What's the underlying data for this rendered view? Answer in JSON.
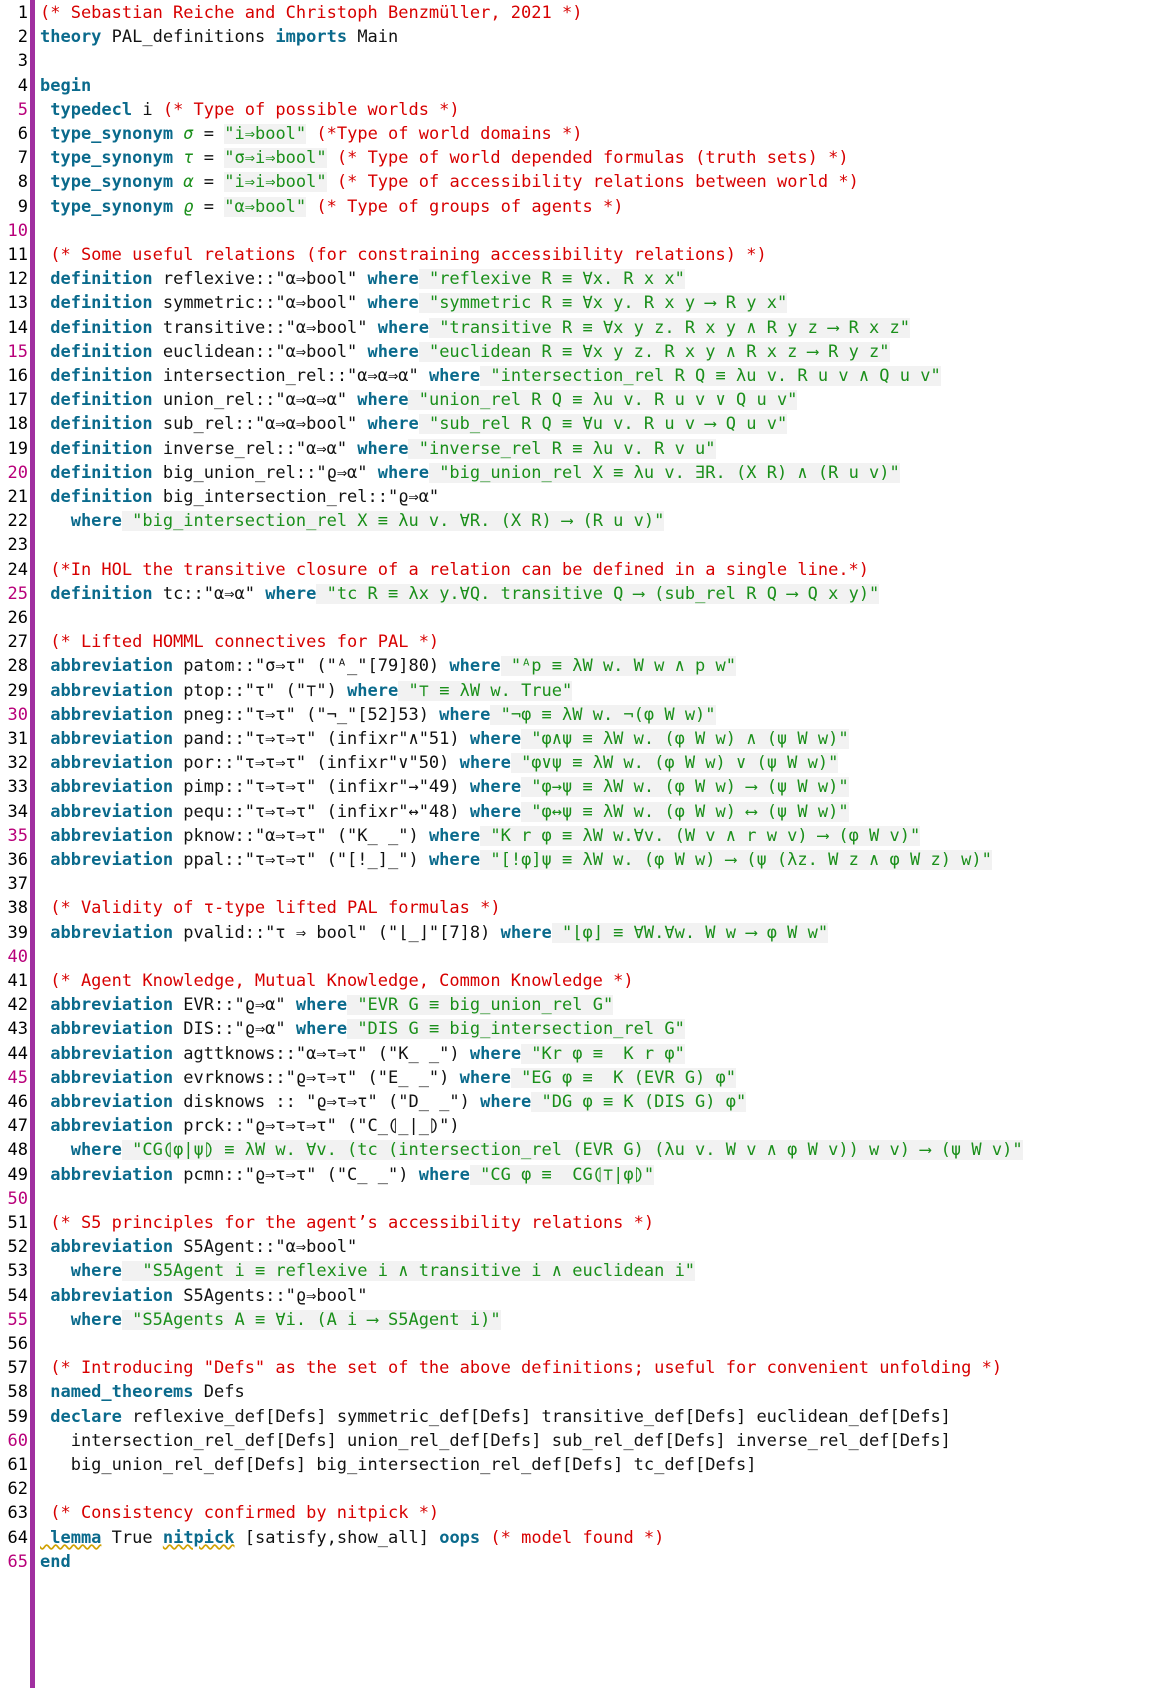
{
  "editor": {
    "title": "PAL_definitions.thy",
    "lines": [
      {
        "n": "1",
        "s": [
          {
            "c": "cm",
            "t": "(* Sebastian Reiche and Christoph Benzmüller, 2021 *)"
          }
        ]
      },
      {
        "n": "2",
        "s": [
          {
            "c": "kw",
            "t": "theory"
          },
          {
            "c": "txt",
            "t": " PAL_definitions "
          },
          {
            "c": "kw",
            "t": "imports"
          },
          {
            "c": "txt",
            "t": " Main"
          }
        ]
      },
      {
        "n": "3",
        "s": []
      },
      {
        "n": "4",
        "s": [
          {
            "c": "kw",
            "t": "begin"
          }
        ]
      },
      {
        "n": "5",
        "mark": true,
        "s": [
          {
            "c": "kw",
            "t": " typedecl"
          },
          {
            "c": "txt",
            "t": " i "
          },
          {
            "c": "cm",
            "t": "(* Type of possible worlds *)"
          }
        ]
      },
      {
        "n": "6",
        "s": [
          {
            "c": "kw",
            "t": " type_synonym"
          },
          {
            "c": "ital",
            "t": " σ"
          },
          {
            "c": "txt",
            "t": " = "
          },
          {
            "c": "str",
            "t": "\"i⇒bool\""
          },
          {
            "c": "cm",
            "t": " (*Type of world domains *)"
          }
        ]
      },
      {
        "n": "7",
        "s": [
          {
            "c": "kw",
            "t": " type_synonym"
          },
          {
            "c": "ital",
            "t": " τ"
          },
          {
            "c": "txt",
            "t": " = "
          },
          {
            "c": "str",
            "t": "\"σ⇒i⇒bool\""
          },
          {
            "c": "cm",
            "t": " (* Type of world depended formulas (truth sets) *)"
          }
        ]
      },
      {
        "n": "8",
        "s": [
          {
            "c": "kw",
            "t": " type_synonym"
          },
          {
            "c": "ital",
            "t": " α"
          },
          {
            "c": "txt",
            "t": " = "
          },
          {
            "c": "str",
            "t": "\"i⇒i⇒bool\""
          },
          {
            "c": "cm",
            "t": " (* Type of accessibility relations between world *)"
          }
        ]
      },
      {
        "n": "9",
        "s": [
          {
            "c": "kw",
            "t": " type_synonym"
          },
          {
            "c": "ital",
            "t": " ϱ"
          },
          {
            "c": "txt",
            "t": " = "
          },
          {
            "c": "str",
            "t": "\"α⇒bool\""
          },
          {
            "c": "cm",
            "t": " (* Type of groups of agents *)"
          }
        ]
      },
      {
        "n": "10",
        "mark": true,
        "s": []
      },
      {
        "n": "11",
        "s": [
          {
            "c": "cm",
            "t": " (* Some useful relations (for constraining accessibility relations) *)"
          }
        ]
      },
      {
        "n": "12",
        "s": [
          {
            "c": "kw",
            "t": " definition"
          },
          {
            "c": "txt",
            "t": " reflexive::\"α⇒bool\" "
          },
          {
            "c": "kw",
            "t": "where"
          },
          {
            "c": "str",
            "t": " \"reflexive R ≡ ∀x. R x x\""
          }
        ]
      },
      {
        "n": "13",
        "s": [
          {
            "c": "kw",
            "t": " definition"
          },
          {
            "c": "txt",
            "t": " symmetric::\"α⇒bool\" "
          },
          {
            "c": "kw",
            "t": "where"
          },
          {
            "c": "str",
            "t": " \"symmetric R ≡ ∀x y. R x y ⟶ R y x\""
          }
        ]
      },
      {
        "n": "14",
        "s": [
          {
            "c": "kw",
            "t": " definition"
          },
          {
            "c": "txt",
            "t": " transitive::\"α⇒bool\" "
          },
          {
            "c": "kw",
            "t": "where"
          },
          {
            "c": "str",
            "t": " \"transitive R ≡ ∀x y z. R x y ∧ R y z ⟶ R x z\""
          }
        ]
      },
      {
        "n": "15",
        "mark": true,
        "s": [
          {
            "c": "kw",
            "t": " definition"
          },
          {
            "c": "txt",
            "t": " euclidean::\"α⇒bool\" "
          },
          {
            "c": "kw",
            "t": "where"
          },
          {
            "c": "str",
            "t": " \"euclidean R ≡ ∀x y z. R x y ∧ R x z ⟶ R y z\""
          }
        ]
      },
      {
        "n": "16",
        "s": [
          {
            "c": "kw",
            "t": " definition"
          },
          {
            "c": "txt",
            "t": " intersection_rel::\"α⇒α⇒α\" "
          },
          {
            "c": "kw",
            "t": "where"
          },
          {
            "c": "str",
            "t": " \"intersection_rel R Q ≡ λu v. R u v ∧ Q u v\""
          }
        ]
      },
      {
        "n": "17",
        "s": [
          {
            "c": "kw",
            "t": " definition"
          },
          {
            "c": "txt",
            "t": " union_rel::\"α⇒α⇒α\" "
          },
          {
            "c": "kw",
            "t": "where"
          },
          {
            "c": "str",
            "t": " \"union_rel R Q ≡ λu v. R u v ∨ Q u v\""
          }
        ]
      },
      {
        "n": "18",
        "s": [
          {
            "c": "kw",
            "t": " definition"
          },
          {
            "c": "txt",
            "t": " sub_rel::\"α⇒α⇒bool\" "
          },
          {
            "c": "kw",
            "t": "where"
          },
          {
            "c": "str",
            "t": " \"sub_rel R Q ≡ ∀u v. R u v ⟶ Q u v\""
          }
        ]
      },
      {
        "n": "19",
        "s": [
          {
            "c": "kw",
            "t": " definition"
          },
          {
            "c": "txt",
            "t": " inverse_rel::\"α⇒α\" "
          },
          {
            "c": "kw",
            "t": "where"
          },
          {
            "c": "str",
            "t": " \"inverse_rel R ≡ λu v. R v u\""
          }
        ]
      },
      {
        "n": "20",
        "mark": true,
        "s": [
          {
            "c": "kw",
            "t": " definition"
          },
          {
            "c": "txt",
            "t": " big_union_rel::\"ϱ⇒α\" "
          },
          {
            "c": "kw",
            "t": "where"
          },
          {
            "c": "str",
            "t": " \"big_union_rel X ≡ λu v. ∃R. (X R) ∧ (R u v)\""
          }
        ]
      },
      {
        "n": "21",
        "s": [
          {
            "c": "kw",
            "t": " definition"
          },
          {
            "c": "txt",
            "t": " big_intersection_rel::\"ϱ⇒α\""
          }
        ]
      },
      {
        "n": "22",
        "s": [
          {
            "c": "kw",
            "t": "   where"
          },
          {
            "c": "str",
            "t": " \"big_intersection_rel X ≡ λu v. ∀R. (X R) ⟶ (R u v)\""
          }
        ]
      },
      {
        "n": "23",
        "s": []
      },
      {
        "n": "24",
        "s": [
          {
            "c": "cm",
            "t": " (*In HOL the transitive closure of a relation can be defined in a single line.*)"
          }
        ]
      },
      {
        "n": "25",
        "mark": true,
        "s": [
          {
            "c": "kw",
            "t": " definition"
          },
          {
            "c": "txt",
            "t": " tc::\"α⇒α\" "
          },
          {
            "c": "kw",
            "t": "where"
          },
          {
            "c": "str",
            "t": " \"tc R ≡ λx y.∀Q. transitive Q ⟶ (sub_rel R Q ⟶ Q x y)\""
          }
        ]
      },
      {
        "n": "26",
        "s": []
      },
      {
        "n": "27",
        "s": [
          {
            "c": "cm",
            "t": " (* Lifted HOMML connectives for PAL *)"
          }
        ]
      },
      {
        "n": "28",
        "s": [
          {
            "c": "kw",
            "t": " abbreviation"
          },
          {
            "c": "txt",
            "t": " patom::\"σ⇒τ\" (\"ᴬ_\"[79]80) "
          },
          {
            "c": "kw",
            "t": "where"
          },
          {
            "c": "str",
            "t": " \"ᴬp ≡ λW w. W w ∧ p w\""
          }
        ]
      },
      {
        "n": "29",
        "s": [
          {
            "c": "kw",
            "t": " abbreviation"
          },
          {
            "c": "txt",
            "t": " ptop::\"τ\" (\"⊤\") "
          },
          {
            "c": "kw",
            "t": "where"
          },
          {
            "c": "str",
            "t": " \"⊤ ≡ λW w. True\""
          }
        ]
      },
      {
        "n": "30",
        "mark": true,
        "s": [
          {
            "c": "kw",
            "t": " abbreviation"
          },
          {
            "c": "txt",
            "t": " pneg::\"τ⇒τ\" (\"¬_\"[52]53) "
          },
          {
            "c": "kw",
            "t": "where"
          },
          {
            "c": "str",
            "t": " \"¬φ ≡ λW w. ¬(φ W w)\""
          }
        ]
      },
      {
        "n": "31",
        "s": [
          {
            "c": "kw",
            "t": " abbreviation"
          },
          {
            "c": "txt",
            "t": " pand::\"τ⇒τ⇒τ\" (infixr\"∧\"51) "
          },
          {
            "c": "kw",
            "t": "where"
          },
          {
            "c": "str",
            "t": " \"φ∧ψ ≡ λW w. (φ W w) ∧ (ψ W w)\""
          }
        ]
      },
      {
        "n": "32",
        "s": [
          {
            "c": "kw",
            "t": " abbreviation"
          },
          {
            "c": "txt",
            "t": " por::\"τ⇒τ⇒τ\" (infixr\"∨\"50) "
          },
          {
            "c": "kw",
            "t": "where"
          },
          {
            "c": "str",
            "t": " \"φ∨ψ ≡ λW w. (φ W w) ∨ (ψ W w)\""
          }
        ]
      },
      {
        "n": "33",
        "s": [
          {
            "c": "kw",
            "t": " abbreviation"
          },
          {
            "c": "txt",
            "t": " pimp::\"τ⇒τ⇒τ\" (infixr\"→\"49) "
          },
          {
            "c": "kw",
            "t": "where"
          },
          {
            "c": "str",
            "t": " \"φ→ψ ≡ λW w. (φ W w) ⟶ (ψ W w)\""
          }
        ]
      },
      {
        "n": "34",
        "s": [
          {
            "c": "kw",
            "t": " abbreviation"
          },
          {
            "c": "txt",
            "t": " pequ::\"τ⇒τ⇒τ\" (infixr\"↔\"48) "
          },
          {
            "c": "kw",
            "t": "where"
          },
          {
            "c": "str",
            "t": " \"φ↔ψ ≡ λW w. (φ W w) ⟷ (ψ W w)\""
          }
        ]
      },
      {
        "n": "35",
        "mark": true,
        "s": [
          {
            "c": "kw",
            "t": " abbreviation"
          },
          {
            "c": "txt",
            "t": " pknow::\"α⇒τ⇒τ\" (\"K_ _\") "
          },
          {
            "c": "kw",
            "t": "where"
          },
          {
            "c": "str",
            "t": " \"K r φ ≡ λW w.∀v. (W v ∧ r w v) ⟶ (φ W v)\""
          }
        ]
      },
      {
        "n": "36",
        "s": [
          {
            "c": "kw",
            "t": " abbreviation"
          },
          {
            "c": "txt",
            "t": " ppal::\"τ⇒τ⇒τ\" (\"[!_]_\") "
          },
          {
            "c": "kw",
            "t": "where"
          },
          {
            "c": "str",
            "t": " \"[!φ]ψ ≡ λW w. (φ W w) ⟶ (ψ (λz. W z ∧ φ W z) w)\""
          }
        ]
      },
      {
        "n": "37",
        "s": []
      },
      {
        "n": "38",
        "s": [
          {
            "c": "cm",
            "t": " (* Validity of τ-type lifted PAL formulas *)"
          }
        ]
      },
      {
        "n": "39",
        "s": [
          {
            "c": "kw",
            "t": " abbreviation"
          },
          {
            "c": "txt",
            "t": " pvalid::\"τ ⇒ bool\" (\"⌊_⌋\"[7]8) "
          },
          {
            "c": "kw",
            "t": "where"
          },
          {
            "c": "str",
            "t": " \"⌊φ⌋ ≡ ∀W.∀w. W w ⟶ φ W w\""
          }
        ]
      },
      {
        "n": "40",
        "mark": true,
        "s": []
      },
      {
        "n": "41",
        "s": [
          {
            "c": "cm",
            "t": " (* Agent Knowledge, Mutual Knowledge, Common Knowledge *)"
          }
        ]
      },
      {
        "n": "42",
        "s": [
          {
            "c": "kw",
            "t": " abbreviation"
          },
          {
            "c": "txt",
            "t": " EVR::\"ϱ⇒α\" "
          },
          {
            "c": "kw",
            "t": "where"
          },
          {
            "c": "str",
            "t": " \"EVR G ≡ big_union_rel G\""
          }
        ]
      },
      {
        "n": "43",
        "s": [
          {
            "c": "kw",
            "t": " abbreviation"
          },
          {
            "c": "txt",
            "t": " DIS::\"ϱ⇒α\" "
          },
          {
            "c": "kw",
            "t": "where"
          },
          {
            "c": "str",
            "t": " \"DIS G ≡ big_intersection_rel G\""
          }
        ]
      },
      {
        "n": "44",
        "s": [
          {
            "c": "kw",
            "t": " abbreviation"
          },
          {
            "c": "txt",
            "t": " agttknows::\"α⇒τ⇒τ\" (\"K_ _\") "
          },
          {
            "c": "kw",
            "t": "where"
          },
          {
            "c": "str",
            "t": " \"Kr φ ≡  K r φ\""
          }
        ]
      },
      {
        "n": "45",
        "mark": true,
        "s": [
          {
            "c": "kw",
            "t": " abbreviation"
          },
          {
            "c": "txt",
            "t": " evrknows::\"ϱ⇒τ⇒τ\" (\"E_ _\") "
          },
          {
            "c": "kw",
            "t": "where"
          },
          {
            "c": "str",
            "t": " \"EG φ ≡  K (EVR G) φ\""
          }
        ]
      },
      {
        "n": "46",
        "s": [
          {
            "c": "kw",
            "t": " abbreviation"
          },
          {
            "c": "txt",
            "t": " disknows :: \"ϱ⇒τ⇒τ\" (\"D_ _\") "
          },
          {
            "c": "kw",
            "t": "where"
          },
          {
            "c": "str",
            "t": " \"DG φ ≡ K (DIS G) φ\""
          }
        ]
      },
      {
        "n": "47",
        "s": [
          {
            "c": "kw",
            "t": " abbreviation"
          },
          {
            "c": "txt",
            "t": " prck::\"ϱ⇒τ⇒τ⇒τ\" (\"C_⦇_|_⦈\")"
          }
        ]
      },
      {
        "n": "48",
        "s": [
          {
            "c": "kw",
            "t": "   where"
          },
          {
            "c": "str",
            "t": " \"CG⦇φ|ψ⦈ ≡ λW w. ∀v. (tc (intersection_rel (EVR G) (λu v. W v ∧ φ W v)) w v) ⟶ (ψ W v)\""
          }
        ]
      },
      {
        "n": "49",
        "s": [
          {
            "c": "kw",
            "t": " abbreviation"
          },
          {
            "c": "txt",
            "t": " pcmn::\"ϱ⇒τ⇒τ\" (\"C_ _\") "
          },
          {
            "c": "kw",
            "t": "where"
          },
          {
            "c": "str",
            "t": " \"CG φ ≡  CG⦇⊤|φ⦈\""
          }
        ]
      },
      {
        "n": "50",
        "mark": true,
        "s": []
      },
      {
        "n": "51",
        "s": [
          {
            "c": "cm",
            "t": " (* S5 principles for the agent’s accessibility relations *)"
          }
        ]
      },
      {
        "n": "52",
        "s": [
          {
            "c": "kw",
            "t": " abbreviation"
          },
          {
            "c": "txt",
            "t": " S5Agent::\"α⇒bool\""
          }
        ]
      },
      {
        "n": "53",
        "s": [
          {
            "c": "kw",
            "t": "   where"
          },
          {
            "c": "str",
            "t": "  \"S5Agent i ≡ reflexive i ∧ transitive i ∧ euclidean i\""
          }
        ]
      },
      {
        "n": "54",
        "s": [
          {
            "c": "kw",
            "t": " abbreviation"
          },
          {
            "c": "txt",
            "t": " S5Agents::\"ϱ⇒bool\""
          }
        ]
      },
      {
        "n": "55",
        "mark": true,
        "s": [
          {
            "c": "kw",
            "t": "   where"
          },
          {
            "c": "str",
            "t": " \"S5Agents A ≡ ∀i. (A i ⟶ S5Agent i)\""
          }
        ]
      },
      {
        "n": "56",
        "s": []
      },
      {
        "n": "57",
        "s": [
          {
            "c": "cm",
            "t": " (* Introducing \"Defs\" as the set of the above definitions; useful for convenient unfolding *)"
          }
        ]
      },
      {
        "n": "58",
        "s": [
          {
            "c": "kw",
            "t": " named_theorems"
          },
          {
            "c": "txt",
            "t": " Defs"
          }
        ]
      },
      {
        "n": "59",
        "s": [
          {
            "c": "kw",
            "t": " declare"
          },
          {
            "c": "txt",
            "t": " reflexive_def[Defs] symmetric_def[Defs] transitive_def[Defs] euclidean_def[Defs]"
          }
        ]
      },
      {
        "n": "60",
        "mark": true,
        "s": [
          {
            "c": "txt",
            "t": "   intersection_rel_def[Defs] union_rel_def[Defs] sub_rel_def[Defs] inverse_rel_def[Defs]"
          }
        ]
      },
      {
        "n": "61",
        "s": [
          {
            "c": "txt",
            "t": "   big_union_rel_def[Defs] big_intersection_rel_def[Defs] tc_def[Defs]"
          }
        ]
      },
      {
        "n": "62",
        "s": []
      },
      {
        "n": "63",
        "s": [
          {
            "c": "cm",
            "t": " (* Consistency confirmed by nitpick *)"
          }
        ]
      },
      {
        "n": "64",
        "s": [
          {
            "c": "kw warn",
            "t": " lemma"
          },
          {
            "c": "txt",
            "t": " True "
          },
          {
            "c": "kw warn",
            "t": "nitpick"
          },
          {
            "c": "txt",
            "t": " [satisfy,show_all] "
          },
          {
            "c": "kw",
            "t": "oops"
          },
          {
            "c": "cm",
            "t": " (* model found *)"
          }
        ]
      },
      {
        "n": "65",
        "mark": true,
        "s": [
          {
            "c": "kw",
            "t": "end"
          }
        ]
      }
    ]
  }
}
